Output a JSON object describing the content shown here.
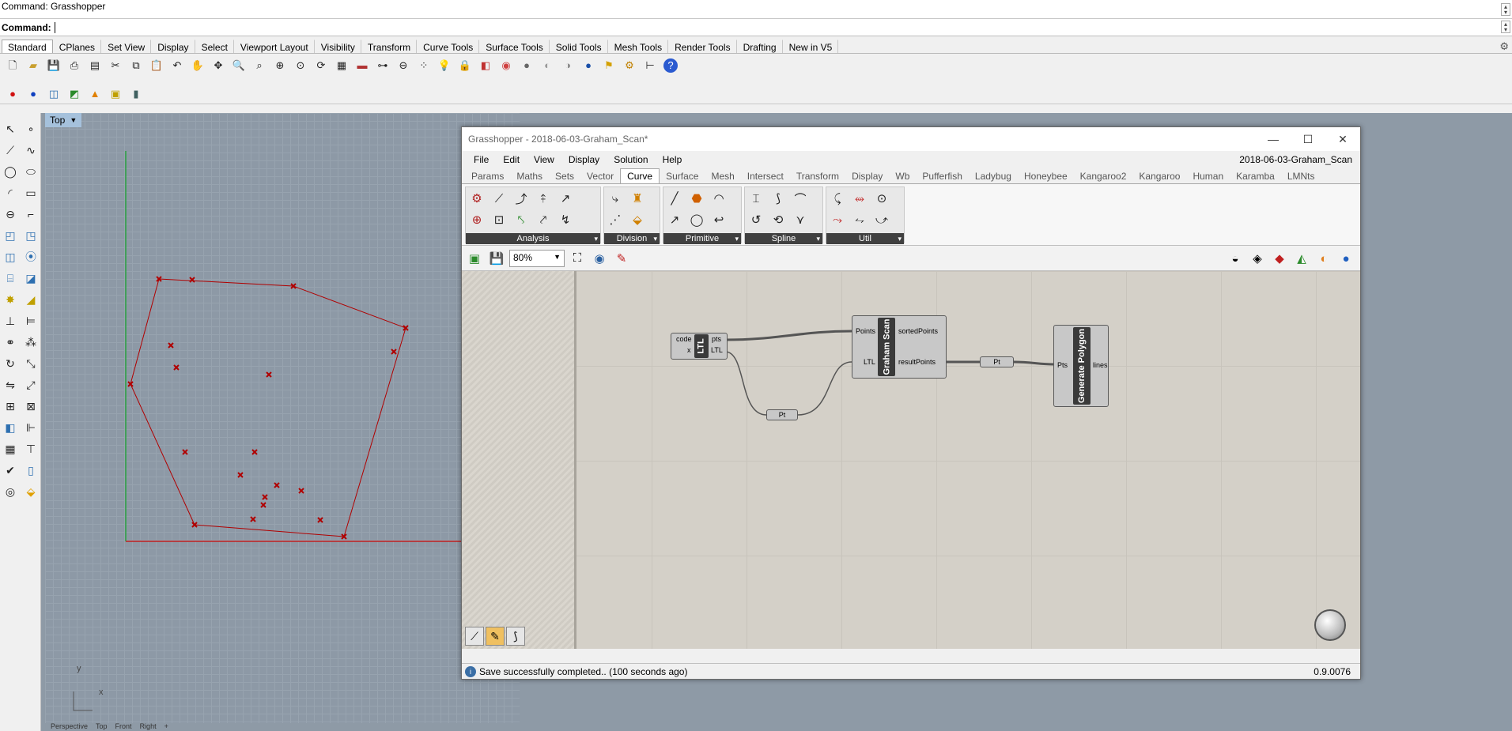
{
  "command_history": "Command: Grasshopper",
  "command_prompt": "Command:",
  "rhino_tabs": [
    {
      "label": "Standard",
      "active": true
    },
    {
      "label": "CPlanes"
    },
    {
      "label": "Set View"
    },
    {
      "label": "Display"
    },
    {
      "label": "Select"
    },
    {
      "label": "Viewport Layout"
    },
    {
      "label": "Visibility"
    },
    {
      "label": "Transform"
    },
    {
      "label": "Curve Tools"
    },
    {
      "label": "Surface Tools"
    },
    {
      "label": "Solid Tools"
    },
    {
      "label": "Mesh Tools"
    },
    {
      "label": "Render Tools"
    },
    {
      "label": "Drafting"
    },
    {
      "label": "New in V5"
    }
  ],
  "viewport": {
    "name": "Top",
    "axis_y": "y",
    "axis_x": "x"
  },
  "viewport_bottom_tabs": [
    "Perspective",
    "Top",
    "Front",
    "Right",
    "+"
  ],
  "point_cloud_color": "#b00000",
  "grasshopper": {
    "title": "Grasshopper - 2018-06-03-Graham_Scan*",
    "document_name": "2018-06-03-Graham_Scan",
    "menu": [
      "File",
      "Edit",
      "View",
      "Display",
      "Solution",
      "Help"
    ],
    "tabs": [
      {
        "label": "Params"
      },
      {
        "label": "Maths"
      },
      {
        "label": "Sets"
      },
      {
        "label": "Vector"
      },
      {
        "label": "Curve",
        "active": true
      },
      {
        "label": "Surface"
      },
      {
        "label": "Mesh"
      },
      {
        "label": "Intersect"
      },
      {
        "label": "Transform"
      },
      {
        "label": "Display"
      },
      {
        "label": "Wb"
      },
      {
        "label": "Pufferfish"
      },
      {
        "label": "Ladybug"
      },
      {
        "label": "Honeybee"
      },
      {
        "label": "Kangaroo2"
      },
      {
        "label": "Kangaroo"
      },
      {
        "label": "Human"
      },
      {
        "label": "Karamba"
      },
      {
        "label": "LMNts"
      }
    ],
    "ribbon_panels": [
      {
        "title": "Analysis",
        "icon_count": 10
      },
      {
        "title": "Division",
        "icon_count": 4
      },
      {
        "title": "Primitive",
        "icon_count": 6
      },
      {
        "title": "Spline",
        "icon_count": 6
      },
      {
        "title": "Util",
        "icon_count": 6
      }
    ],
    "zoom": "80%",
    "components": {
      "ltl": {
        "name": "LTL",
        "inputs": [
          "code",
          "x"
        ],
        "outputs": [
          "pts",
          "LTL"
        ]
      },
      "graham": {
        "name": "Graham Scan",
        "inputs": [
          "Points",
          "LTL"
        ],
        "outputs": [
          "sortedPoints",
          "resultPoints"
        ]
      },
      "polygon": {
        "name": "Generate Polygon",
        "inputs": [
          "Pts"
        ],
        "outputs": [
          "lines"
        ]
      },
      "pt_a": "Pt",
      "pt_b": "Pt"
    },
    "status": "Save successfully completed.. (100 seconds ago)",
    "version": "0.9.0076"
  }
}
